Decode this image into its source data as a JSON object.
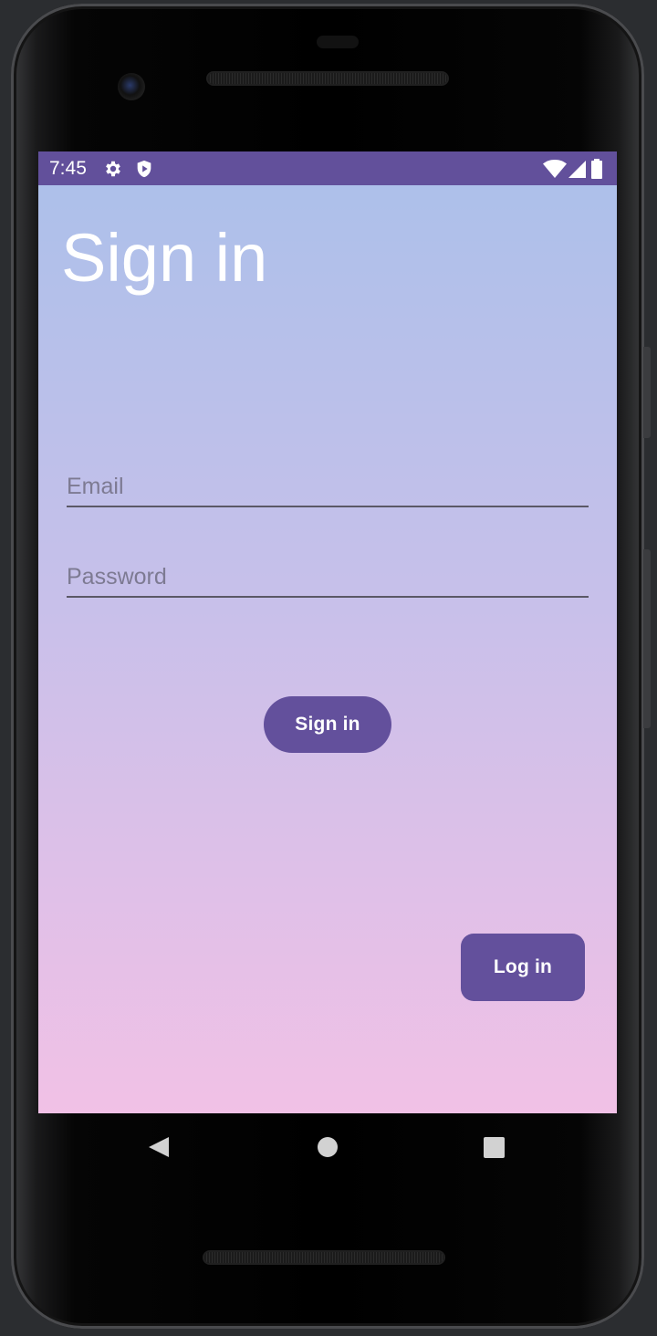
{
  "status_bar": {
    "time": "7:45",
    "left_icons": [
      "gear-icon",
      "shield-play-icon"
    ],
    "right_icons": [
      "wifi-icon",
      "cellular-signal-icon",
      "battery-icon"
    ],
    "background": "#62509b"
  },
  "screen": {
    "title": "Sign in",
    "gradient_top": "#abc0ea",
    "gradient_bottom": "#f1c1e6"
  },
  "form": {
    "email_placeholder": "Email",
    "email_value": "",
    "password_placeholder": "Password",
    "password_value": ""
  },
  "buttons": {
    "sign_in_label": "Sign in",
    "log_in_label": "Log in",
    "color": "#63509c"
  },
  "navigation_bar": {
    "items": [
      "back-icon",
      "home-icon",
      "recents-icon"
    ]
  }
}
